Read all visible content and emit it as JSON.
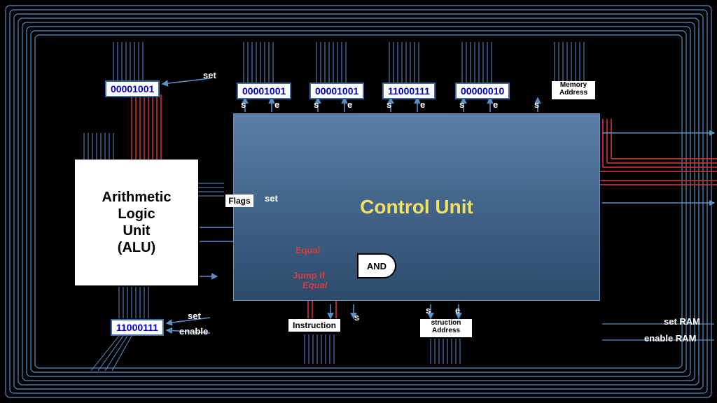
{
  "registers": {
    "alu_in": "00001001",
    "r0": "00001001",
    "r1": "00001001",
    "r2": "11000111",
    "r3": "00000010",
    "alu_out": "11000111",
    "memory_addr": "Memory\nAddress",
    "instruction": "Instruction",
    "instr_addr": "struction\nAddress"
  },
  "labels": {
    "set_top": "set",
    "s": "s",
    "e": "e",
    "set": "set",
    "enable": "enable",
    "flags": "Flags",
    "equal": "Equal",
    "jump_if": "Jump If",
    "jump_equal": "Equal",
    "and": "AND",
    "set_ram": "set RAM",
    "enable_ram": "enable RAM"
  },
  "blocks": {
    "alu": "Arithmetic\nLogic\nUnit\n(ALU)",
    "control_unit": "Control Unit"
  }
}
